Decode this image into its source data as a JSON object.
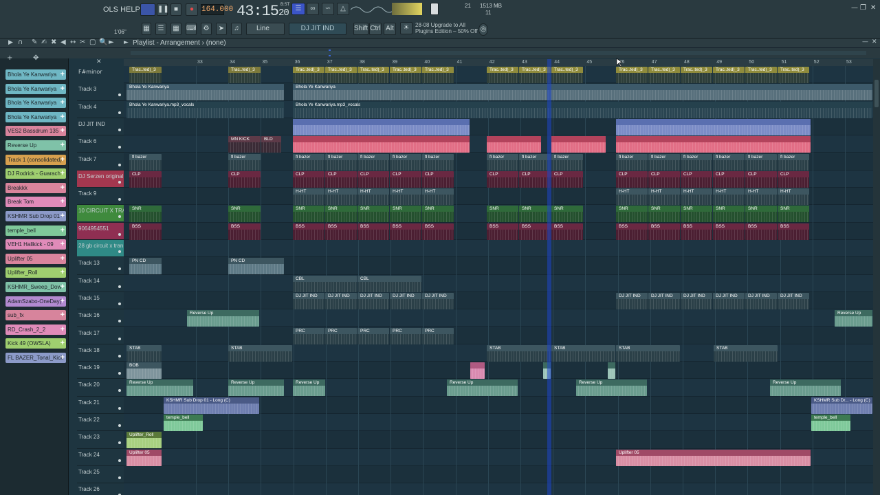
{
  "menu": {
    "tools_help": "OLS HELP"
  },
  "transport": {
    "tempo": "164.000",
    "time": "43:15",
    "time_small": "20",
    "time_unit_top": "B:ST",
    "cpu_top": "21",
    "memory": "1513 MB",
    "voices": "11",
    "seek_label": "1'06\"",
    "snap_label": "Line",
    "pattern_label": "DJ JIT IND",
    "shift_label": "Shift",
    "ctrl_label": "Ctrl",
    "alt_label": "Alt",
    "upgrade_line1": "28-08  Upgrade to All",
    "upgrade_line2": "Plugins Edition – 50% Off"
  },
  "playlist": {
    "title": "Playlist - Arrangement",
    "pattern": "(none)",
    "key_label": "F#minor"
  },
  "picker": [
    {
      "label": "Bhola Ye Kanwariya",
      "color": "#6fb7c4"
    },
    {
      "label": "Bhola Ye Kanwariya",
      "color": "#6fb7c4"
    },
    {
      "label": "Bhola Ye Kanwariya",
      "color": "#6fb7c4"
    },
    {
      "label": "Bhola Ye Kanwariya",
      "color": "#6fb7c4"
    },
    {
      "label": "VES2 Bassdrum 135",
      "color": "#d9849c"
    },
    {
      "label": "Reverse Up",
      "color": "#7fc2a8"
    },
    {
      "label": "Track 1 (consolidated)",
      "color": "#d7a04e"
    },
    {
      "label": "DJ Rodrick - Guarach",
      "color": "#9fcf6f"
    },
    {
      "label": "Breakkk",
      "color": "#d9849c"
    },
    {
      "label": "Break Tom",
      "color": "#e08bb9"
    },
    {
      "label": "KSHMR Sub Drop 01 -",
      "color": "#8c9ac8"
    },
    {
      "label": "temple_bell",
      "color": "#7fc99a"
    },
    {
      "label": "VEH1 Hallkick - 09",
      "color": "#e08bb9"
    },
    {
      "label": "Uplifter 05",
      "color": "#d9849c"
    },
    {
      "label": "Uplifter_Roll",
      "color": "#9fcf6f"
    },
    {
      "label": "KSHMR_Sweep_Dow",
      "color": "#7fc2a8"
    },
    {
      "label": "AdamSzabo-OneDay(",
      "color": "#b38ad0"
    },
    {
      "label": "sub_fx",
      "color": "#d7849c"
    },
    {
      "label": "RD_Crash_2_2",
      "color": "#e08bb9"
    },
    {
      "label": "Kick 49 (OWSLA)",
      "color": "#9fcf6f"
    },
    {
      "label": "FL BAZER_Tonal_Kick",
      "color": "#8c9ac8"
    }
  ],
  "tracks": [
    {
      "label": "",
      "color": ""
    },
    {
      "label": "Track 3",
      "color": ""
    },
    {
      "label": "Track 4",
      "color": ""
    },
    {
      "label": "DJ JIT IND",
      "color": ""
    },
    {
      "label": "Track 6",
      "color": ""
    },
    {
      "label": "Track 7",
      "color": ""
    },
    {
      "label": "DJ Serzen original",
      "color": "#a3374f"
    },
    {
      "label": "Track 9",
      "color": ""
    },
    {
      "label": "10 CIRCUIT X TRAN",
      "color": "#3f8a3d"
    },
    {
      "label": "9064954551",
      "color": "#8f2f52"
    },
    {
      "label": "28 gb circuit x tran",
      "color": "#2f8a86"
    },
    {
      "label": "Track 13",
      "color": ""
    },
    {
      "label": "Track 14",
      "color": ""
    },
    {
      "label": "Track 15",
      "color": ""
    },
    {
      "label": "Track 16",
      "color": ""
    },
    {
      "label": "Track 17",
      "color": ""
    },
    {
      "label": "Track 18",
      "color": ""
    },
    {
      "label": "Track 19",
      "color": ""
    },
    {
      "label": "Track 20",
      "color": ""
    },
    {
      "label": "Track 21",
      "color": ""
    },
    {
      "label": "Track 22",
      "color": ""
    },
    {
      "label": "Track 23",
      "color": ""
    },
    {
      "label": "Track 24",
      "color": ""
    },
    {
      "label": "Track 25",
      "color": ""
    },
    {
      "label": "Track 26",
      "color": ""
    }
  ],
  "bars": [
    "33",
    "34",
    "35",
    "36",
    "37",
    "38",
    "39",
    "40",
    "41",
    "42",
    "43",
    "44",
    "45",
    "46",
    "47",
    "48",
    "49",
    "50",
    "51",
    "52",
    "53"
  ],
  "clips": {
    "trac": "Trac..ted)_3",
    "bhola": "Bhola Ye Kanwariya",
    "bhola_vocals": "Bhola Ye Kanwariya.mp3_vocals",
    "mn_kick": "MN KICK",
    "bld": "BLD",
    "fl_bazer": "fl bazer",
    "clp": "CLP",
    "hht": "H-HT",
    "snr": "SNR",
    "bss": "BSS",
    "pn_cd": "PN CD",
    "cbl": "CBL",
    "dj_jit": "DJ JIT IND",
    "reverse_up": "Reverse Up",
    "prc": "PRC",
    "stab": "STAB",
    "bob": "BOB",
    "kshmr": "KSHMR Sub Drop 01 - Long (C)",
    "kshmr_short": "KSHMR Sub Dr... - Long (C)",
    "temple": "temple_bell",
    "uplifter_roll": "Uplifter_Roll",
    "uplifter": "Uplifter 05"
  }
}
